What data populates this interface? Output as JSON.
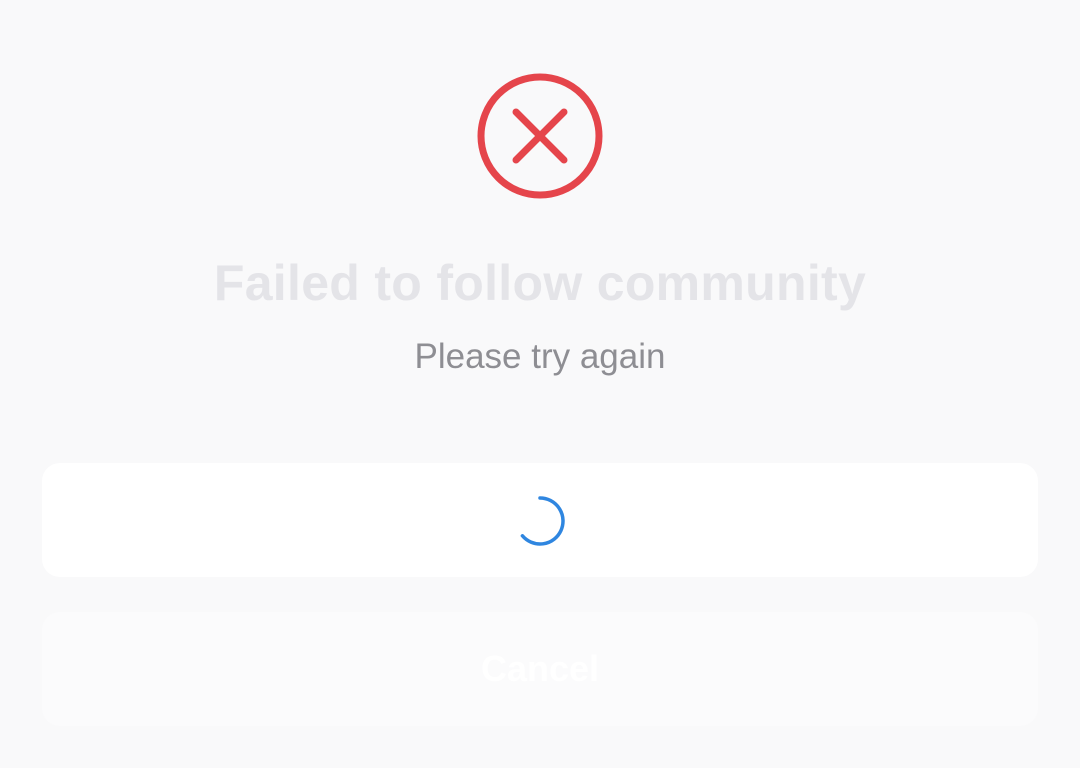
{
  "dialog": {
    "icon": "error-circle-x-icon",
    "title": "Failed to follow community",
    "message": "Please try again",
    "retry": {
      "state": "loading",
      "icon": "loading-spinner-icon"
    },
    "cancel_label": "Cancel"
  },
  "colors": {
    "background": "#f9f9fa",
    "error": "#e5454b",
    "title": "#e4e4e8",
    "message": "#8e8e93",
    "spinner": "#2f86e0",
    "button": "#ffffff"
  }
}
